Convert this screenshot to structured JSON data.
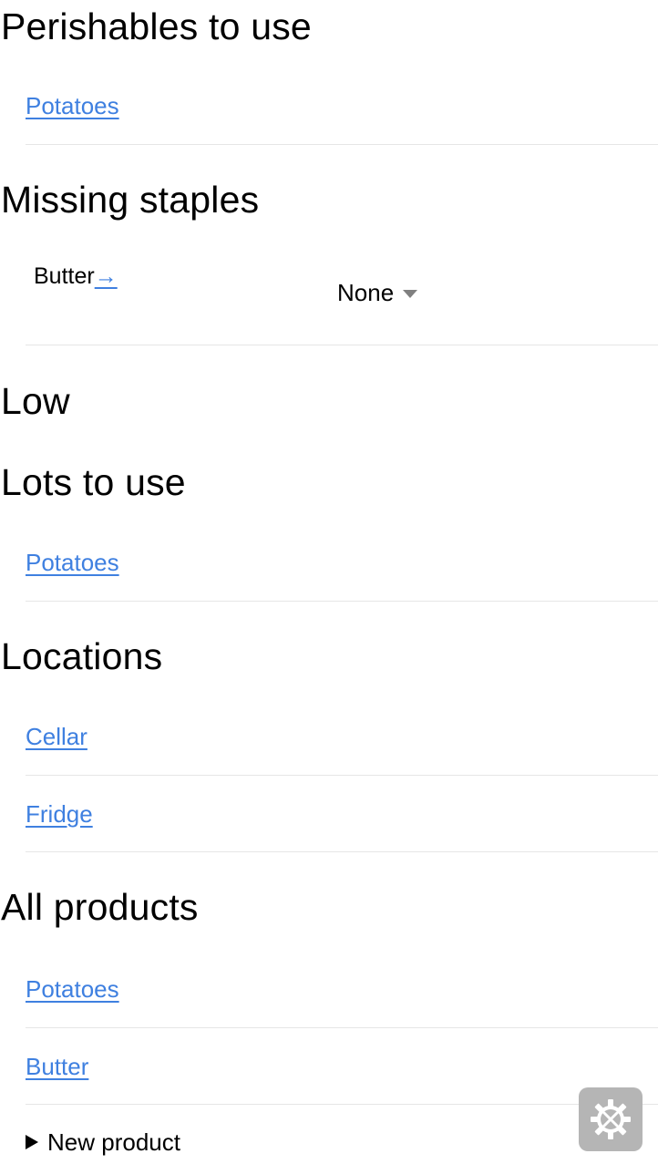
{
  "sections": {
    "perishables": {
      "heading": "Perishables to use",
      "items": [
        "Potatoes"
      ]
    },
    "missing_staples": {
      "heading": "Missing staples",
      "item": {
        "name": "Butter",
        "arrow": "→",
        "select_value": "None"
      }
    },
    "low": {
      "heading": "Low"
    },
    "lots_to_use": {
      "heading": "Lots to use",
      "items": [
        "Potatoes"
      ]
    },
    "locations": {
      "heading": "Locations",
      "items": [
        "Cellar",
        "Fridge"
      ]
    },
    "all_products": {
      "heading": "All products",
      "items": [
        "Potatoes",
        "Butter"
      ],
      "new_product_label": "New product"
    }
  },
  "floating_button": {
    "icon": "gear-tools-icon",
    "color": "#b5b5b5"
  },
  "colors": {
    "link": "#3f80e0",
    "divider": "#e6e6e6"
  }
}
